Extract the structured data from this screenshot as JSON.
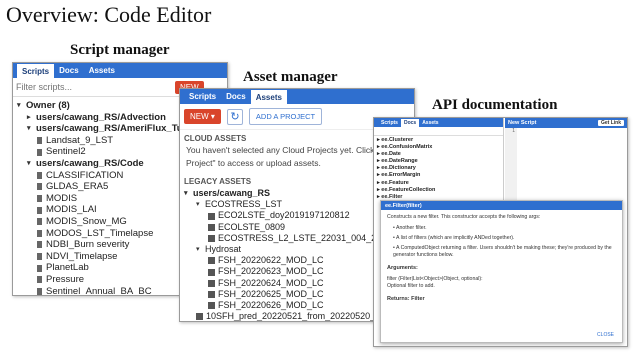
{
  "slide": {
    "title": "Overview: Code Editor",
    "captions": {
      "script": "Script manager",
      "asset": "Asset manager",
      "api": "API documentation"
    }
  },
  "script_manager": {
    "tabs": [
      "Scripts",
      "Docs",
      "Assets"
    ],
    "filter_placeholder": "Filter scripts...",
    "new_button": "NEW",
    "tree": [
      {
        "label": "Owner (8)",
        "type": "folder",
        "expanded": true,
        "indent": 0
      },
      {
        "label": "users/cawang_RS/Advection",
        "type": "folder",
        "expanded": false,
        "indent": 1
      },
      {
        "label": "users/cawang_RS/AmeriFlux_Tutorial",
        "type": "folder",
        "expanded": true,
        "indent": 1
      },
      {
        "label": "Landsat_9_LST",
        "type": "file",
        "indent": 2
      },
      {
        "label": "Sentinel2",
        "type": "file",
        "indent": 2
      },
      {
        "label": "users/cawang_RS/Code",
        "type": "folder",
        "expanded": true,
        "indent": 1
      },
      {
        "label": "CLASSIFICATION",
        "type": "file",
        "indent": 2
      },
      {
        "label": "GLDAS_ERA5",
        "type": "file",
        "indent": 2
      },
      {
        "label": "MODIS",
        "type": "file",
        "indent": 2
      },
      {
        "label": "MODIS_LAI",
        "type": "file",
        "indent": 2
      },
      {
        "label": "MODIS_Snow_MG",
        "type": "file",
        "indent": 2
      },
      {
        "label": "MODOS_LST_Timelapse",
        "type": "file",
        "indent": 2
      },
      {
        "label": "NDBI_Burn severity",
        "type": "file",
        "indent": 2
      },
      {
        "label": "NDVI_Timelapse",
        "type": "file",
        "indent": 2
      },
      {
        "label": "PlanetLab",
        "type": "file",
        "indent": 2
      },
      {
        "label": "Pressure",
        "type": "file",
        "indent": 2
      },
      {
        "label": "Sentinel_Annual_BA_BC",
        "type": "file",
        "indent": 2
      }
    ]
  },
  "asset_manager": {
    "tabs": [
      "Scripts",
      "Docs",
      "Assets"
    ],
    "new_button": "NEW",
    "add_project_button": "ADD A PROJECT",
    "cloud_heading": "CLOUD ASSETS",
    "cloud_text_1": "You haven't selected any Cloud Projects yet. Click",
    "cloud_text_2": "Project\" to access or upload assets.",
    "legacy_heading": "LEGACY ASSETS",
    "tree": [
      {
        "label": "users/cawang_RS",
        "type": "folder",
        "indent": 0
      },
      {
        "label": "ECOSTRESS_LST",
        "type": "folder",
        "indent": 1
      },
      {
        "label": "ECO2LSTE_doy2019197120812",
        "type": "image",
        "indent": 2
      },
      {
        "label": "ECOLSTE_0809",
        "type": "image",
        "indent": 2
      },
      {
        "label": "ECOSTRESS_L2_LSTE_22031_004_2022051",
        "type": "image",
        "indent": 2
      },
      {
        "label": "Hydrosat",
        "type": "folder",
        "indent": 1
      },
      {
        "label": "FSH_20220622_MOD_LC",
        "type": "image",
        "indent": 2
      },
      {
        "label": "FSH_20220623_MOD_LC",
        "type": "image",
        "indent": 2
      },
      {
        "label": "FSH_20220624_MOD_LC",
        "type": "image",
        "indent": 2
      },
      {
        "label": "FSH_20220625_MOD_LC",
        "type": "image",
        "indent": 2
      },
      {
        "label": "FSH_20220626_MOD_LC",
        "type": "image",
        "indent": 2
      },
      {
        "label": "10SFH_pred_20220521_from_20220520_usin",
        "type": "image",
        "indent": 1
      }
    ]
  },
  "api_doc": {
    "tabs": [
      "Scripts",
      "Docs",
      "Assets"
    ],
    "list": [
      "ee.Clusterer",
      "ee.ConfusionMatrix",
      "ee.Date",
      "ee.DateRange",
      "ee.Dictionary",
      "ee.ErrorMargin",
      "ee.Feature",
      "ee.FeatureCollection",
      "ee.Filter"
    ],
    "editor_title": "New Script",
    "get_link": "Get Link",
    "line_number": "1",
    "popup_title": "ee.Filter(filter)",
    "description": "Constructs a new filter. This constructor accepts the following args:",
    "bullets": [
      "Another filter.",
      "A list of filters (which are implicitly ANDed together).",
      "A ComputedObject returning a filter. Users shouldn't be making these; they're produced by the generator functions below."
    ],
    "arguments_heading": "Arguments:",
    "argument_name": "filter (Filter|List<Object>|Object, optional):",
    "argument_desc": "Optional filter to add.",
    "returns": "Returns: Filter",
    "close": "CLOSE"
  }
}
